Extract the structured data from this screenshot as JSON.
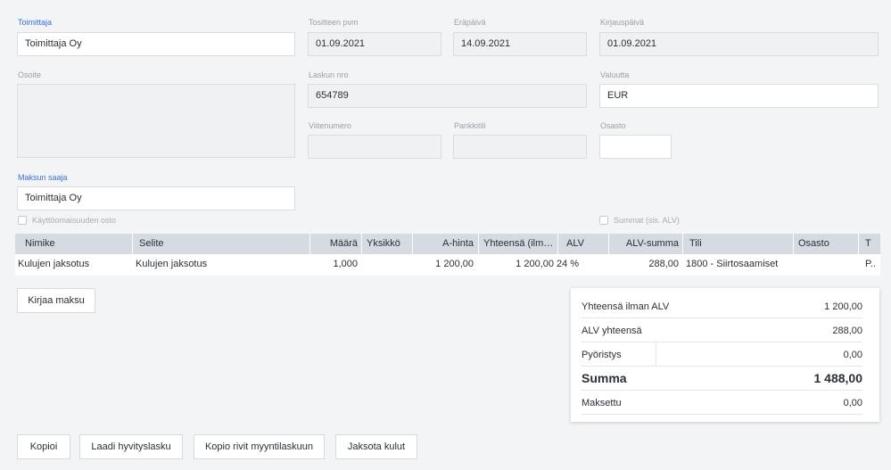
{
  "supplier": {
    "label": "Toimittaja",
    "value": "Toimittaja Oy"
  },
  "voucher_date": {
    "label": "Tositteen pvm",
    "value": "01.09.2021"
  },
  "due_date": {
    "label": "Eräpäivä",
    "value": "14.09.2021"
  },
  "booking_date": {
    "label": "Kirjauspäivä",
    "value": "01.09.2021"
  },
  "address": {
    "label": "Osoite",
    "value": ""
  },
  "invoice_no": {
    "label": "Laskun nro",
    "value": "654789"
  },
  "currency": {
    "label": "Valuutta",
    "value": "EUR"
  },
  "reference_no": {
    "label": "Viitenumero",
    "value": ""
  },
  "bank_account": {
    "label": "Pankkitili",
    "value": ""
  },
  "department": {
    "label": "Osasto",
    "value": ""
  },
  "payee": {
    "label": "Maksun saaja",
    "value": "Toimittaja Oy"
  },
  "fixed_asset_checkbox": {
    "label": "Käyttöomaisuuden osto",
    "checked": false
  },
  "sums_incl_vat_checkbox": {
    "label": "Summat (sis. ALV)",
    "checked": false
  },
  "table": {
    "headers": [
      "Nimike",
      "Selite",
      "Määrä",
      "Yksikkö",
      "A-hinta",
      "Yhteensä (ilm…",
      "ALV",
      "ALV-summa",
      "Tili",
      "Osasto",
      "T"
    ],
    "rows": [
      [
        "Kulujen jaksotus",
        "Kulujen jaksotus",
        "1,000",
        "",
        "1 200,00",
        "1 200,00",
        "24 %",
        "288,00",
        "1800 - Siirtosaamiset",
        "",
        "P.."
      ]
    ]
  },
  "buttons": {
    "book_payment": "Kirjaa maksu",
    "copy": "Kopioi",
    "credit_note": "Laadi hyvityslasku",
    "copy_rows_sales": "Kopio rivit myyntilaskuun",
    "allocate_costs": "Jaksota kulut"
  },
  "totals": {
    "excl_vat": {
      "label": "Yhteensä ilman ALV",
      "value": "1 200,00"
    },
    "vat_total": {
      "label": "ALV yhteensä",
      "value": "288,00"
    },
    "rounding": {
      "label": "Pyöristys",
      "value": "0,00"
    },
    "sum": {
      "label": "Summa",
      "value": "1 488,00"
    },
    "paid": {
      "label": "Maksettu",
      "value": "0,00"
    }
  },
  "colors": {
    "accent_label": "#3b6fd8",
    "header_bg": "#d6dae1",
    "page_bg": "#f3f4f6"
  }
}
